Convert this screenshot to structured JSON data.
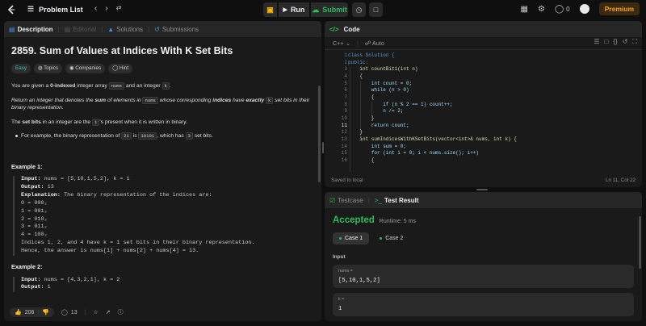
{
  "topbar": {
    "problem_list": "Problem List",
    "run": "Run",
    "submit": "Submit",
    "coins": "0",
    "premium": "Premium"
  },
  "description_panel": {
    "tabs": [
      "Description",
      "Editorial",
      "Solutions",
      "Submissions"
    ],
    "title": "2859. Sum of Values at Indices With K Set Bits",
    "tags": [
      "Easy",
      "Topics",
      "Companies",
      "Hint"
    ],
    "p1_a": "You are given a ",
    "p1_b": "0-indexed",
    "p1_c": " integer array ",
    "p1_code1": "nums",
    "p1_d": " and an integer ",
    "p1_code2": "k",
    "p1_e": ".",
    "p2_a": "Return an integer that denotes the ",
    "p2_b": "sum",
    "p2_c": " of elements in ",
    "p2_code": "nums",
    "p2_d": " whose corresponding ",
    "p2_e": "indices",
    "p2_f": " have ",
    "p2_g": "exactly",
    "p2_code2": "k",
    "p2_h": " set bits in their binary representation.",
    "p3_a": "The ",
    "p3_b": "set bits",
    "p3_c": " in an integer are the ",
    "p3_code": "1",
    "p3_d": "'s present when it is written in binary.",
    "bullet_a": "For example, the binary representation of ",
    "bullet_code1": "21",
    "bullet_b": " is ",
    "bullet_code2": "10101",
    "bullet_c": ", which has ",
    "bullet_code3": "3",
    "bullet_d": " set bits.",
    "example1_heading": "Example 1:",
    "example1_input_label": "Input:",
    "example1_input": " nums = [5,10,1,5,2], k = 1",
    "example1_output_label": "Output:",
    "example1_output": " 13",
    "example1_expl_label": "Explanation:",
    "example1_expl": " The binary representation of the indices are:",
    "example1_lines": [
      "0 = 000₂",
      "1 = 001₂",
      "2 = 010₂",
      "3 = 011₂",
      "4 = 100₂",
      "Indices 1, 2, and 4 have k = 1 set bits in their binary representation.",
      "Hence, the answer is nums[1] + nums[2] + nums[4] = 13."
    ],
    "example2_heading": "Example 2:",
    "example2_input_label": "Input:",
    "example2_input": " nums = [4,3,2,1], k = 2",
    "example2_output_label": "Output:",
    "example2_output": " 1",
    "likes": "206",
    "comments": "13"
  },
  "code_panel": {
    "tab": "Code",
    "language": "C++",
    "mode": "Auto",
    "status": "Saved to local",
    "cursor": "Ln 11, Col 22",
    "line_numbers": [
      "1",
      "2",
      "3",
      "4",
      "5",
      "6",
      "7",
      "8",
      "9",
      "10",
      "11",
      "12",
      "13",
      "14",
      "15",
      "16"
    ],
    "current_line": "11",
    "code_lines": [
      "class Solution {",
      "public:",
      "    int countBit1(int n)",
      "    {",
      "        int count = 0;",
      "        while (n > 0)",
      "        {",
      "            if (n % 2 == 1) count++;",
      "            n /= 2;",
      "        }",
      "        return count;",
      "    }",
      "    int sumIndicesWithKSetBits(vector<int>& nums, int k) {",
      "        int sum = 0;",
      "        for (int i = 0; i < nums.size(); i++)",
      "        {"
    ]
  },
  "test_panel": {
    "tabs": [
      "Testcase",
      "Test Result"
    ],
    "verdict": "Accepted",
    "runtime": "Runtime: 5 ms",
    "cases": [
      "Case 1",
      "Case 2"
    ],
    "input_label": "Input",
    "params": [
      {
        "name": "nums =",
        "value": "[5,10,1,5,2]"
      },
      {
        "name": "k =",
        "value": "1"
      }
    ]
  },
  "colors": {
    "accent_green": "#2cbb5d",
    "accent_orange": "#ffa116",
    "easy": "#46c6c2"
  }
}
